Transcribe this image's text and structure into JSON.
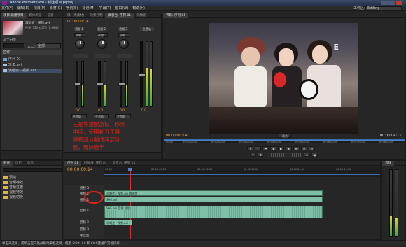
{
  "window": {
    "title": "Adobe Premiere Pro - 新建项目.prproj"
  },
  "menu": [
    "文件(F)",
    "编辑(E)",
    "项目(P)",
    "素材(C)",
    "序列(S)",
    "标记(M)",
    "字幕(T)",
    "窗口(W)",
    "帮助(H)"
  ],
  "workspace": {
    "label": "工作区:",
    "value": "Editing"
  },
  "project_panel": {
    "tabs": [
      "项目:新建项目",
      "媒体浏览",
      "信息"
    ],
    "thumb_name": "演唱会 - 视频.avi",
    "thumb_info": "视频, 720 x 576 (1.0940)",
    "file_count": "3 个分项",
    "search_placeholder": "",
    "in_label": "入口:",
    "in_value": "全部",
    "col_header": "名称",
    "items": [
      "序列 01",
      "SHE.avi",
      "演唱会 - 视频.avi"
    ]
  },
  "mixer": {
    "tabs": [
      "源: (无素材)",
      "效果控制",
      "调音台: 序列 01",
      "元数据"
    ],
    "timecode": "00:00:00:14",
    "channel_labels": [
      "音频 1",
      "音频 2",
      "音频 3",
      "主音轨"
    ],
    "reads": [
      "读取",
      "读取",
      "读取"
    ],
    "vals": [
      "0.0",
      "0.0",
      "0.0",
      "0.0"
    ],
    "master_label": "主音轨",
    "route": [
      "主音轨",
      "主音轨",
      "主音轨"
    ]
  },
  "annotation": [
    "三是将播放游标，移到",
    "中间，使用剃刀工具",
    "将视频分割成两部分",
    "后，删除后半"
  ],
  "program": {
    "tab": "节目: 序列 01",
    "video_logo_text": "S.H.E",
    "timecode_left": "00:00:00:14",
    "fit_label": "适合",
    "timecode_right": "00:00:04:11",
    "ruler_ticks": [
      "00:00",
      "00:01:00:00",
      "00:02:00:00",
      "00:03:00:00",
      "00:04:00:00",
      "00:05:00:00",
      "00:06:00:00",
      "00:07:00:00",
      "00:08:00:00"
    ]
  },
  "effects_panel": {
    "tabs": [
      "效果",
      "历史",
      "信息"
    ],
    "folders": [
      "预设",
      "音频特效",
      "音频过渡",
      "视频特效",
      "视频切换"
    ]
  },
  "timeline": {
    "tab": "序列 01",
    "tabs2": [
      "时间线: 序列 01",
      "调音台: 序列 01"
    ],
    "timecode": "00:00:00:14",
    "ruler": [
      "00:00",
      "00:00:05:00",
      "00:00:10:00",
      "00:00:15:00",
      "00:00:20:00",
      "00:00:25:00"
    ],
    "video_tracks": [
      "视频 3",
      "视频 2",
      "视频 1"
    ],
    "audio_tracks": [
      "音频 1",
      "音频 2",
      "音频 3",
      "主音轨"
    ],
    "clip_v2": "演唱会 - 视频.avi 透明度",
    "clip_v1": "SHE.avi",
    "clip_v1b": "演唱会 - 视频.avi",
    "clip_a1": "SHE.avi 音量:级别",
    "clip_a2": "演唱会 - 视频.avi",
    "clip_a3": "演唱会"
  },
  "audio_meter": {
    "label": "音频"
  },
  "status": {
    "text": "单击来选择，或单击空白处并拖动来框选择。使用 Shift, Alt 和 Ctrl 键进行其他操作。"
  },
  "colors": {
    "accent": "#e8a33a",
    "annotation": "#e0231a",
    "clip_green": "#7fbfa7",
    "timeline_blue": "#3d6fb0"
  }
}
